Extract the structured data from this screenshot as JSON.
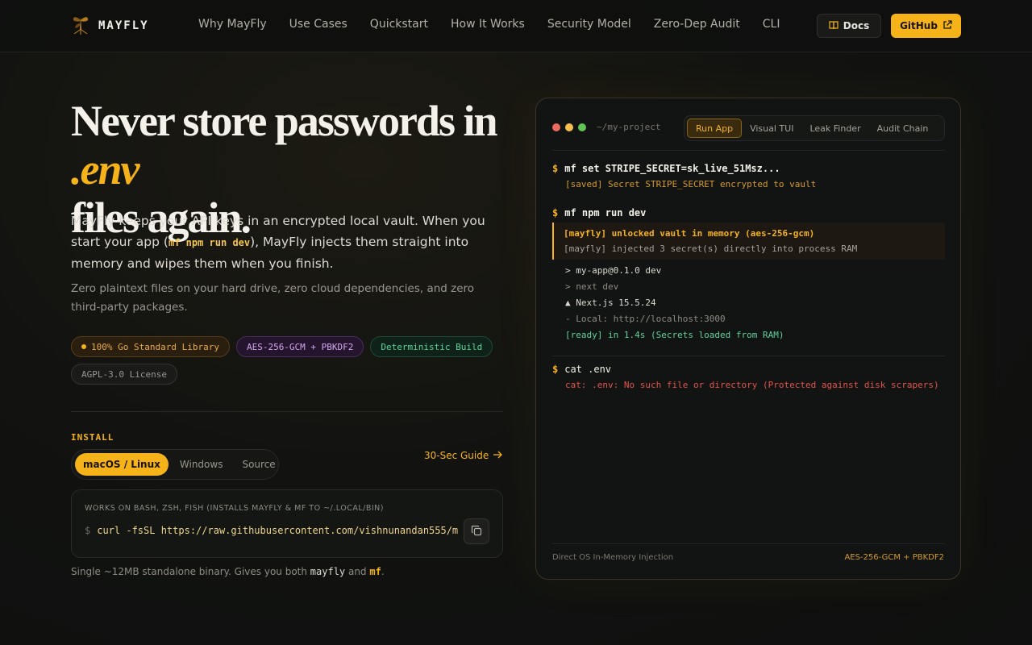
{
  "brand": {
    "name": "MAYFLY"
  },
  "nav": {
    "links": [
      "Why MayFly",
      "Use Cases",
      "Quickstart",
      "How It Works",
      "Security Model",
      "Zero-Dep Audit",
      "CLI"
    ],
    "docs_label": "Docs",
    "github_label": "GitHub"
  },
  "hero": {
    "title_part1": "Never store passwords in ",
    "title_accent": ".env",
    "title_part2": "files again.",
    "desc_part1": "MayFly keeps your API keys in an encrypted local vault. When you start your app (",
    "desc_code": "mf npm run dev",
    "desc_part2": "), MayFly injects them straight into memory and wipes them when you finish.",
    "sub": "Zero plaintext files on your hard drive, zero cloud dependencies, and zero third-party packages.",
    "badges": [
      "100% Go Standard Library",
      "AES-256-GCM + PBKDF2",
      "Deterministic Build",
      "AGPL-3.0 License"
    ]
  },
  "install": {
    "label": "INSTALL",
    "tabs": [
      "macOS / Linux",
      "Windows",
      "Source"
    ],
    "active_tab": "macOS / Linux",
    "guide_label": "30-Sec Guide",
    "note": "WORKS ON BASH, ZSH, FISH (INSTALLS MAYFLY & MF TO ~/.LOCAL/BIN)",
    "prompt": "$",
    "command": "curl -fsSL https://raw.githubusercontent.com/vishnunandan555/m",
    "foot_part1": "Single ~12MB standalone binary. Gives you both ",
    "foot_bin1": "mayfly",
    "foot_and": " and ",
    "foot_bin2": "mf",
    "foot_end": "."
  },
  "terminal": {
    "path": "~/my-project",
    "tabs": [
      "Run App",
      "Visual TUI",
      "Leak Finder",
      "Audit Chain"
    ],
    "active_tab": "Run App",
    "cmd1": "mf set STRIPE_SECRET=sk_live_51Msz...",
    "out1": "[saved] Secret STRIPE_SECRET encrypted to vault",
    "cmd2": "mf npm run dev",
    "block_l1": "[mayfly] unlocked vault in memory (aes-256-gcm)",
    "block_l2": "[mayfly] injected 3 secret(s) directly into process RAM",
    "out2": [
      "> my-app@0.1.0 dev",
      "> next dev",
      "▲ Next.js 15.5.24",
      "- Local: http://localhost:3000",
      "[ready] in 1.4s (Secrets loaded from RAM)"
    ],
    "cmd3": "cat .env",
    "out3": "cat: .env: No such file or directory (Protected against disk scrapers)",
    "foot_left": "Direct OS In-Memory Injection",
    "foot_right": "AES-256-GCM + PBKDF2"
  },
  "colors": {
    "accent": "#f5b319",
    "background": "#121311",
    "success": "#5fd39b",
    "error": "#e5534b",
    "dot_red": "#ed6a5e",
    "dot_yellow": "#f5bf4f",
    "dot_green": "#61c454"
  }
}
